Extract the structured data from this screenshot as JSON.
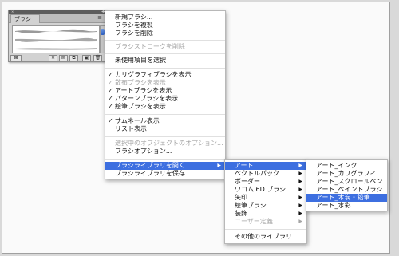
{
  "panel": {
    "tab_label": "ブラシ",
    "collapse_glyph": "◂◂",
    "close_glyph": "×",
    "menu_glyph": "≡",
    "bottom_buttons": [
      "⊞",
      "✕",
      "⊟",
      "⧉",
      "▣",
      "🗑"
    ]
  },
  "context_menu": {
    "items": [
      {
        "label": "新規ブラシ...",
        "checked": false,
        "disabled": false
      },
      {
        "label": "ブラシを複製",
        "checked": false,
        "disabled": false
      },
      {
        "label": "ブラシを削除",
        "checked": false,
        "disabled": false
      },
      {
        "label": "ブラシストロークを削除",
        "checked": false,
        "disabled": true
      },
      {
        "label": "未使用項目を選択",
        "checked": false,
        "disabled": false
      },
      {
        "label": "カリグラフィブラシを表示",
        "checked": true,
        "disabled": false
      },
      {
        "label": "散布ブラシを表示",
        "checked": true,
        "disabled": true
      },
      {
        "label": "アートブラシを表示",
        "checked": true,
        "disabled": false
      },
      {
        "label": "パターンブラシを表示",
        "checked": true,
        "disabled": false
      },
      {
        "label": "絵筆ブラシを表示",
        "checked": true,
        "disabled": false
      },
      {
        "label": "サムネール表示",
        "checked": true,
        "disabled": false
      },
      {
        "label": "リスト表示",
        "checked": false,
        "disabled": false
      },
      {
        "label": "選択中のオブジェクトのオプション...",
        "checked": false,
        "disabled": true
      },
      {
        "label": "ブラシオプション...",
        "checked": false,
        "disabled": false
      },
      {
        "label": "ブラシライブラリを開く",
        "checked": false,
        "disabled": false,
        "submenu": true,
        "highlighted": true
      },
      {
        "label": "ブラシライブラリを保存...",
        "checked": false,
        "disabled": false
      }
    ],
    "check_glyph": "✓",
    "arrow_glyph": "▶"
  },
  "library_menu": {
    "items": [
      {
        "label": "アート",
        "submenu": true,
        "highlighted": true
      },
      {
        "label": "ベクトルパック",
        "submenu": true
      },
      {
        "label": "ボーダー",
        "submenu": true
      },
      {
        "label": "ワコム 6D ブラシ",
        "submenu": true
      },
      {
        "label": "矢印",
        "submenu": true
      },
      {
        "label": "絵筆ブラシ",
        "submenu": true
      },
      {
        "label": "装飾",
        "submenu": true
      },
      {
        "label": "ユーザー定義",
        "submenu": true,
        "disabled": true
      },
      {
        "label": "その他のライブラリ..."
      }
    ]
  },
  "art_menu": {
    "items": [
      {
        "label": "アート_インク"
      },
      {
        "label": "アート_カリグラフィ"
      },
      {
        "label": "アート_スクロールペン"
      },
      {
        "label": "アート_ペイントブラシ"
      },
      {
        "label": "アート_木炭・鉛筆",
        "highlighted": true
      },
      {
        "label": "アート_水彩"
      }
    ]
  },
  "colors": {
    "highlight": "#3d6fe0",
    "disabled_text": "#a5a5a5",
    "panel_bg": "#d2d2d2"
  }
}
